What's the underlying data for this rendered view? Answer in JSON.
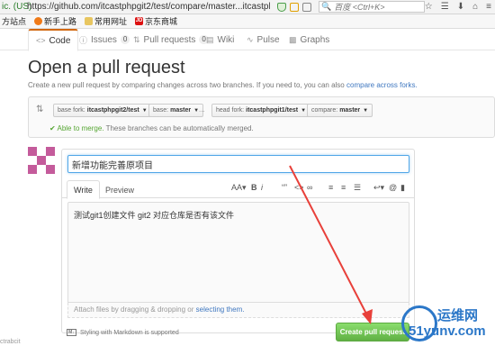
{
  "browser": {
    "security_prefix": "ic. (US)",
    "url": "https://github.com/itcastphpgit2/test/compare/master...itcastphpgi",
    "search_placeholder": "百度 <Ctrl+K>"
  },
  "bookmarks": [
    {
      "label": "方站点",
      "icon": "none"
    },
    {
      "label": "新手上路",
      "icon": "firefox-icon"
    },
    {
      "label": "常用网址",
      "icon": "folder-icon"
    },
    {
      "label": "京东商城",
      "icon": "jd-icon"
    }
  ],
  "reponav": {
    "code": "Code",
    "issues": "Issues",
    "issues_count": "0",
    "pulls": "Pull requests",
    "pulls_count": "0",
    "wiki": "Wiki",
    "pulse": "Pulse",
    "graphs": "Graphs"
  },
  "page": {
    "title": "Open a pull request",
    "subtitle": "Create a new pull request by comparing changes across two branches. If you need to, you can also",
    "subtitle_link": "compare across forks."
  },
  "compare": {
    "base_fork_label": "base fork:",
    "base_fork": "itcastphpgit2/test",
    "base_label": "base:",
    "base": "master",
    "head_fork_label": "head fork:",
    "head_fork": "itcastphpgit1/test",
    "compare_label": "compare:",
    "compare": "master",
    "merge_ok": "Able to merge.",
    "merge_note": "These branches can be automatically merged."
  },
  "pr": {
    "title_value": "新增功能完善原项目",
    "write_tab": "Write",
    "preview_tab": "Preview",
    "body": "测试git1创建文件    git2   对应仓库是否有该文件",
    "attach_text": "Attach files by dragging & dropping or",
    "attach_link": "selecting them.",
    "markdown_note": "Styling with Markdown is supported",
    "create_button": "Create pull request"
  },
  "footer": {
    "bottom_left": "ctrabcit"
  },
  "watermark": {
    "top": "运维网",
    "bottom": "51yunv.com"
  },
  "colors": {
    "accent_orange": "#d26911",
    "link_blue": "#4078c0",
    "merge_green": "#55a532",
    "button_green": "#60b044",
    "arrow_red": "#e8403a"
  }
}
